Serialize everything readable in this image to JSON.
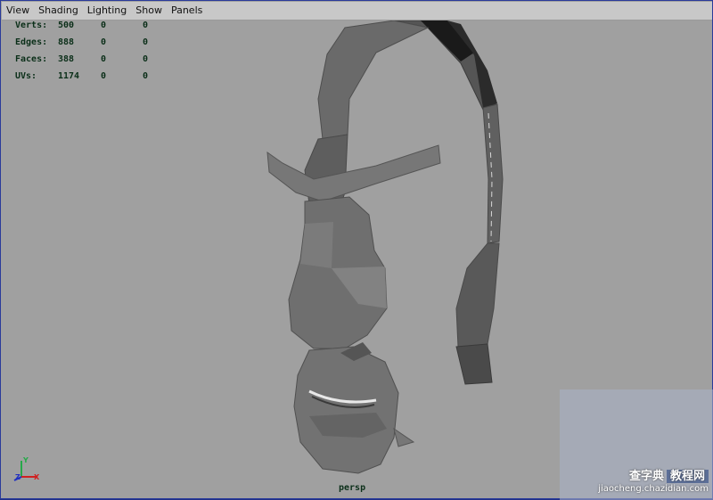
{
  "menu": {
    "items": [
      "View",
      "Shading",
      "Lighting",
      "Show",
      "Panels"
    ]
  },
  "hud": {
    "rows": [
      {
        "label": "Verts:",
        "v1": "500",
        "v2": "0",
        "v3": "0"
      },
      {
        "label": "Edges:",
        "v1": "888",
        "v2": "0",
        "v3": "0"
      },
      {
        "label": "Faces:",
        "v1": "388",
        "v2": "0",
        "v3": "0"
      },
      {
        "label": "UVs:",
        "v1": "1174",
        "v2": "0",
        "v3": "0"
      }
    ]
  },
  "camera_label": "persp",
  "axis": {
    "y": "Y",
    "x": "X",
    "z": "Z"
  },
  "watermark": {
    "main": "查字典",
    "box": "教程网",
    "url": "jiaocheng.chazidian.com"
  },
  "colors": {
    "viewport_bg": "#a0a0a0",
    "menubar_bg": "#c8c8c8",
    "hud_text": "#0b2f19"
  }
}
